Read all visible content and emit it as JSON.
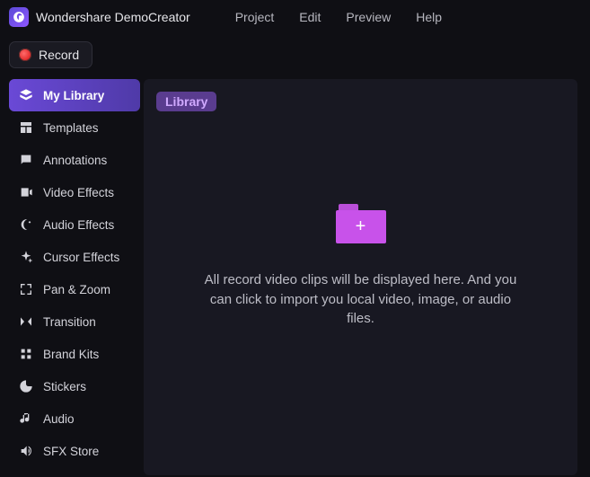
{
  "app": {
    "title": "Wondershare DemoCreator"
  },
  "menu": {
    "project": "Project",
    "edit": "Edit",
    "preview": "Preview",
    "help": "Help"
  },
  "toolbar": {
    "record_label": "Record"
  },
  "sidebar": {
    "items": [
      {
        "label": "My Library"
      },
      {
        "label": "Templates"
      },
      {
        "label": "Annotations"
      },
      {
        "label": "Video Effects"
      },
      {
        "label": "Audio Effects"
      },
      {
        "label": "Cursor Effects"
      },
      {
        "label": "Pan & Zoom"
      },
      {
        "label": "Transition"
      },
      {
        "label": "Brand Kits"
      },
      {
        "label": "Stickers"
      },
      {
        "label": "Audio"
      },
      {
        "label": "SFX Store"
      }
    ]
  },
  "library": {
    "tag": "Library",
    "hint": "All record video clips will be displayed here. And you can click to import you local video, image, or audio files."
  }
}
